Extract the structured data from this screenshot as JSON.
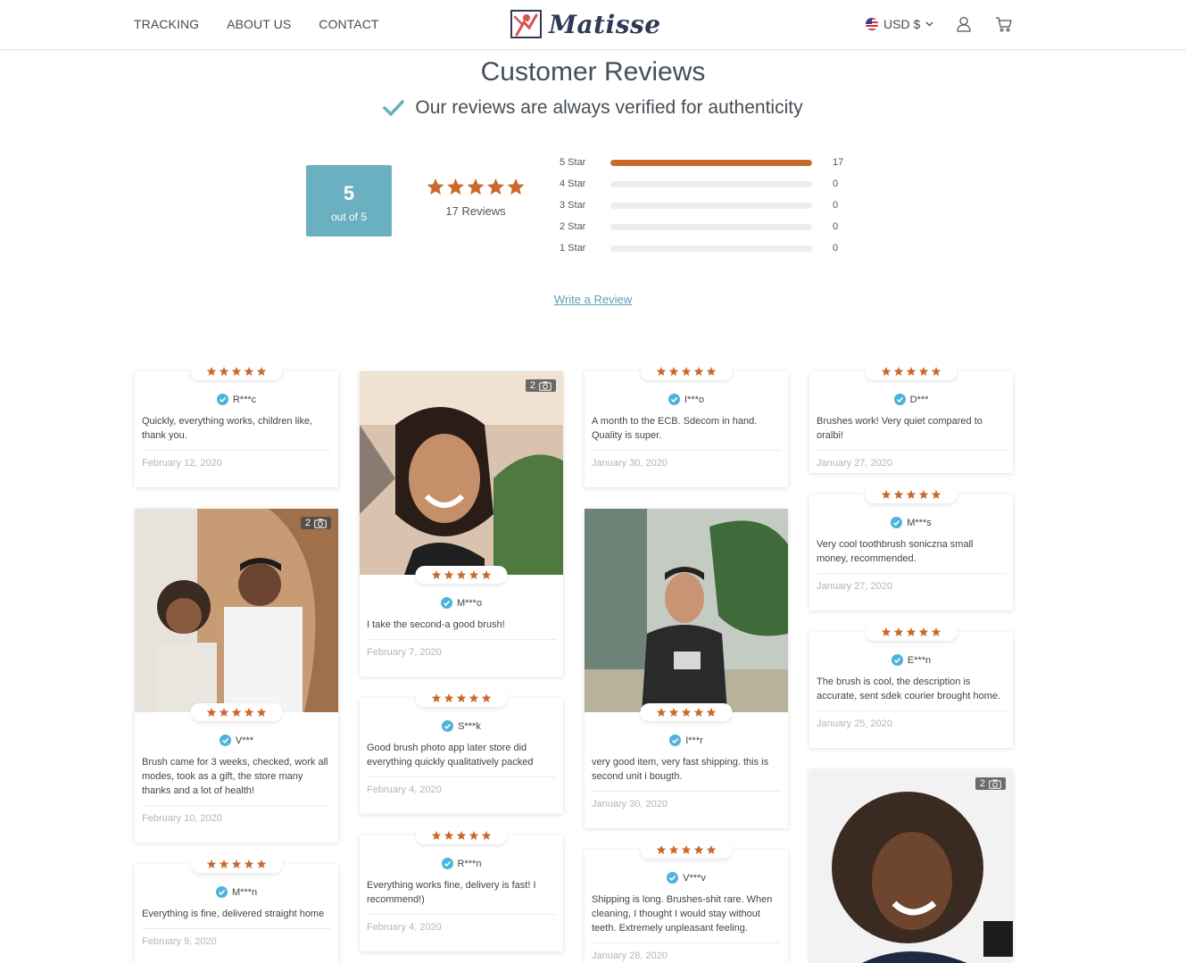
{
  "nav": {
    "items": [
      "TRACKING",
      "ABOUT US",
      "CONTACT"
    ]
  },
  "brand": {
    "name": "Matisse"
  },
  "currency": {
    "label": "USD $"
  },
  "summary": {
    "title": "Customer Reviews",
    "verified_text": "Our reviews are always verified for authenticity",
    "score": "5",
    "out_of": "out of 5",
    "review_count_text": "17  Reviews",
    "average_rating": 5,
    "breakdown": [
      {
        "label": "5 Star",
        "count": "17",
        "fraction": 1.0
      },
      {
        "label": "4 Star",
        "count": "0",
        "fraction": 0
      },
      {
        "label": "3 Star",
        "count": "0",
        "fraction": 0
      },
      {
        "label": "2 Star",
        "count": "0",
        "fraction": 0
      },
      {
        "label": "1 Star",
        "count": "0",
        "fraction": 0
      }
    ],
    "write_review": "Write a Review"
  },
  "colors": {
    "star": "#c9692a",
    "accent": "#6ab0c1",
    "verified_check": "#4fb2d8",
    "link": "#5a9fb5"
  },
  "reviews": [
    {
      "name": "R***c",
      "rating": 5,
      "text": "Quickly, everything works, children like, thank you.",
      "date": "February 12, 2020"
    },
    {
      "name": "V***",
      "rating": 5,
      "text": "Brush came for 3 weeks, checked, work all modes, took as a gift, the store many thanks and a lot of health!",
      "date": "February 10, 2020",
      "photo_count": "2"
    },
    {
      "name": "M***n",
      "rating": 5,
      "text": "Everything is fine, delivered straight home",
      "date": "February 9, 2020"
    },
    {
      "name": "M***o",
      "rating": 5,
      "text": "I take the second-a good brush!",
      "date": "February 7, 2020",
      "photo_count": "2"
    },
    {
      "name": "S***k",
      "rating": 5,
      "text": "Good brush photo app later store did everything quickly qualitatively packed",
      "date": "February 4, 2020"
    },
    {
      "name": "R***n",
      "rating": 5,
      "text": "Everything works fine, delivery is fast! I recommend!)",
      "date": "February 4, 2020"
    },
    {
      "name": "I***o",
      "rating": 5,
      "text": "A month to the ECB. Sdecom in hand. Quality is super.",
      "date": "January 30, 2020"
    },
    {
      "name": "I***r",
      "rating": 5,
      "text": "very good item, very fast shipping. this is second unit i bougth.",
      "date": "January 30, 2020"
    },
    {
      "name": "V***v",
      "rating": 5,
      "text": "Shipping is long. Brushes-shit rare. When cleaning, I thought I would stay without teeth. Extremely unpleasant feeling.",
      "date": "January 28, 2020"
    },
    {
      "name": "D***",
      "rating": 5,
      "text": "Brushes work! Very quiet compared to oralbi!",
      "date": "January 27, 2020"
    },
    {
      "name": "M***s",
      "rating": 5,
      "text": "Very cool toothbrush sonicznа small money, recommended.",
      "date": "January 27, 2020"
    },
    {
      "name": "E***n",
      "rating": 5,
      "text": "The brush is cool, the description is accurate, sent sdek courier brought home.",
      "date": "January 25, 2020"
    },
    {
      "photo_count": "2"
    }
  ]
}
